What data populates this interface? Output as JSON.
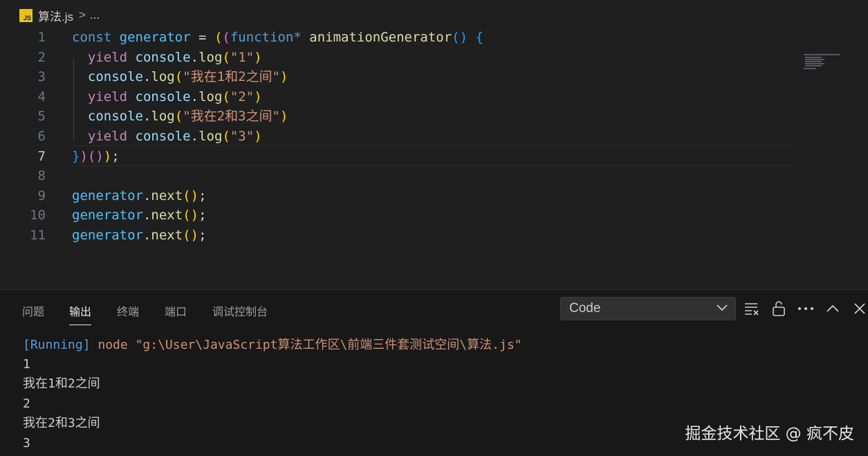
{
  "breadcrumb": {
    "file_icon_label": "JS",
    "file_name": "算法.js",
    "separator": ">",
    "more": "..."
  },
  "editor": {
    "current_line": 7,
    "line_numbers": [
      "1",
      "2",
      "3",
      "4",
      "5",
      "6",
      "7",
      "8",
      "9",
      "10",
      "11"
    ],
    "lines": [
      [
        {
          "t": "const",
          "c": "kw"
        },
        {
          "t": " "
        },
        {
          "t": "generator",
          "c": "var"
        },
        {
          "t": " = ",
          "c": "plain"
        },
        {
          "t": "(",
          "c": "b1"
        },
        {
          "t": "(",
          "c": "b2"
        },
        {
          "t": "function*",
          "c": "kw"
        },
        {
          "t": " "
        },
        {
          "t": "animationGenerator",
          "c": "fn"
        },
        {
          "t": "()",
          "c": "b3"
        },
        {
          "t": " "
        },
        {
          "t": "{",
          "c": "b3"
        }
      ],
      [
        {
          "t": "  "
        },
        {
          "t": "yield",
          "c": "ctl"
        },
        {
          "t": " "
        },
        {
          "t": "console",
          "c": "obj"
        },
        {
          "t": ".",
          "c": "plain"
        },
        {
          "t": "log",
          "c": "fn"
        },
        {
          "t": "(",
          "c": "b1"
        },
        {
          "t": "\"1\"",
          "c": "str"
        },
        {
          "t": ")",
          "c": "b1"
        }
      ],
      [
        {
          "t": "  "
        },
        {
          "t": "console",
          "c": "obj"
        },
        {
          "t": ".",
          "c": "plain"
        },
        {
          "t": "log",
          "c": "fn"
        },
        {
          "t": "(",
          "c": "b1"
        },
        {
          "t": "\"我在1和2之间\"",
          "c": "str"
        },
        {
          "t": ")",
          "c": "b1"
        }
      ],
      [
        {
          "t": "  "
        },
        {
          "t": "yield",
          "c": "ctl"
        },
        {
          "t": " "
        },
        {
          "t": "console",
          "c": "obj"
        },
        {
          "t": ".",
          "c": "plain"
        },
        {
          "t": "log",
          "c": "fn"
        },
        {
          "t": "(",
          "c": "b1"
        },
        {
          "t": "\"2\"",
          "c": "str"
        },
        {
          "t": ")",
          "c": "b1"
        }
      ],
      [
        {
          "t": "  "
        },
        {
          "t": "console",
          "c": "obj"
        },
        {
          "t": ".",
          "c": "plain"
        },
        {
          "t": "log",
          "c": "fn"
        },
        {
          "t": "(",
          "c": "b1"
        },
        {
          "t": "\"我在2和3之间\"",
          "c": "str"
        },
        {
          "t": ")",
          "c": "b1"
        }
      ],
      [
        {
          "t": "  "
        },
        {
          "t": "yield",
          "c": "ctl"
        },
        {
          "t": " "
        },
        {
          "t": "console",
          "c": "obj"
        },
        {
          "t": ".",
          "c": "plain"
        },
        {
          "t": "log",
          "c": "fn"
        },
        {
          "t": "(",
          "c": "b1"
        },
        {
          "t": "\"3\"",
          "c": "str"
        },
        {
          "t": ")",
          "c": "b1"
        }
      ],
      [
        {
          "t": "}",
          "c": "b3"
        },
        {
          "t": ")",
          "c": "b2"
        },
        {
          "t": "()",
          "c": "b2"
        },
        {
          "t": ")",
          "c": "b1"
        },
        {
          "t": ";",
          "c": "plain"
        }
      ],
      [],
      [
        {
          "t": "generator",
          "c": "var"
        },
        {
          "t": ".",
          "c": "plain"
        },
        {
          "t": "next",
          "c": "fn"
        },
        {
          "t": "()",
          "c": "b1"
        },
        {
          "t": ";",
          "c": "plain"
        }
      ],
      [
        {
          "t": "generator",
          "c": "var"
        },
        {
          "t": ".",
          "c": "plain"
        },
        {
          "t": "next",
          "c": "fn"
        },
        {
          "t": "()",
          "c": "b1"
        },
        {
          "t": ";",
          "c": "plain"
        }
      ],
      [
        {
          "t": "generator",
          "c": "var"
        },
        {
          "t": ".",
          "c": "plain"
        },
        {
          "t": "next",
          "c": "fn"
        },
        {
          "t": "()",
          "c": "b1"
        },
        {
          "t": ";",
          "c": "plain"
        }
      ]
    ]
  },
  "panel": {
    "tabs": [
      {
        "label": "问题",
        "active": false
      },
      {
        "label": "输出",
        "active": true
      },
      {
        "label": "终端",
        "active": false
      },
      {
        "label": "端口",
        "active": false
      },
      {
        "label": "调试控制台",
        "active": false
      }
    ],
    "channel_select": {
      "value": "Code"
    },
    "icons": [
      "clear-output-icon",
      "lock-icon",
      "more-icon",
      "maximize-icon",
      "close-icon"
    ],
    "output": {
      "running_tag": "[Running]",
      "command": " node \"g:\\User\\JavaScript算法工作区\\前端三件套测试空间\\算法.js\"",
      "lines": [
        "1",
        "我在1和2之间",
        "2",
        "我在2和3之间",
        "3"
      ]
    }
  },
  "watermark": "掘金技术社区 @ 疯不皮",
  "colors": {
    "background": "#1f1f1f",
    "panel_background": "#181818",
    "keyword": "#569cd6",
    "variable": "#4fc1ff",
    "function": "#dcdcaa",
    "string": "#ce9178",
    "control": "#c586c0"
  }
}
